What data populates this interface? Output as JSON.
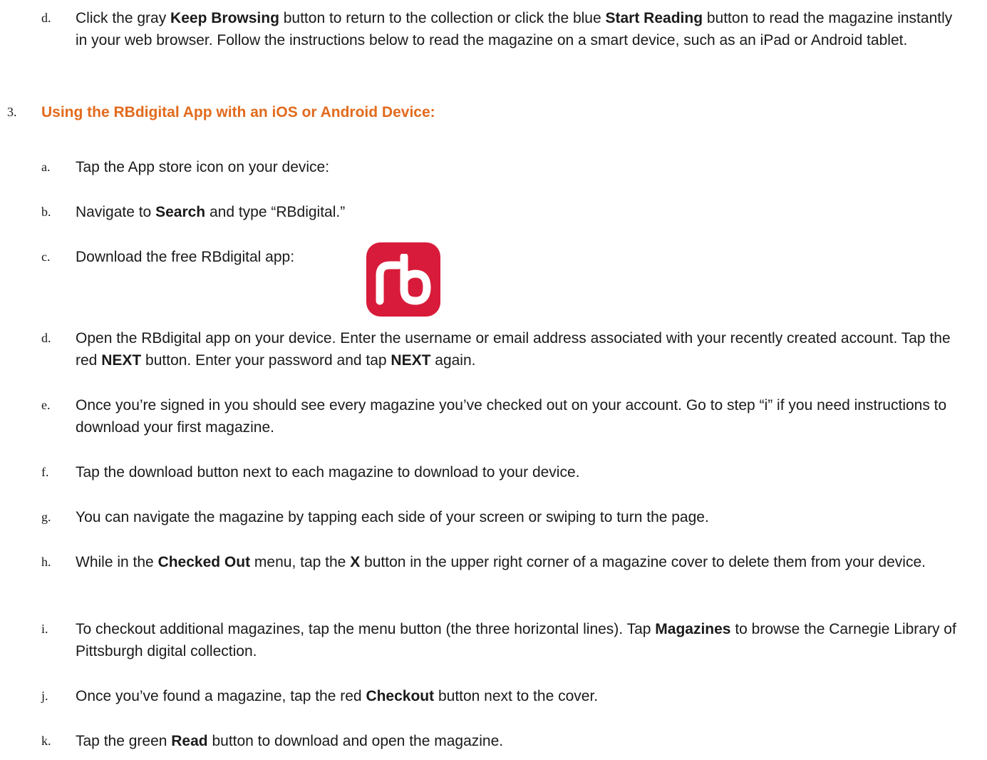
{
  "step_d_top": {
    "marker": "d.",
    "p1": "Click the gray ",
    "b1": "Keep Browsing",
    "p2": " button to return to the collection or click the blue ",
    "b2": "Start Reading",
    "p3": " button to read the magazine instantly in your web browser.  Follow the instructions below to read the magazine on a smart device, such as an iPad or Android tablet."
  },
  "section": {
    "number": "3.",
    "heading": "Using the RBdigital App with an iOS or Android Device:"
  },
  "steps": {
    "a": {
      "marker": "a.",
      "p1": "Tap the App store icon on your device:"
    },
    "b": {
      "marker": "b.",
      "p1": "Navigate to ",
      "b1": "Search",
      "p2": " and type “RBdigital.”"
    },
    "c": {
      "marker": "c.",
      "p1": "Download the free RBdigital app:"
    },
    "d": {
      "marker": "d.",
      "p1": "Open the RBdigital app on your device.  Enter the username or email address associated with your recently created account.  Tap the red ",
      "b1": "NEXT",
      "p2": " button.  Enter your password and tap ",
      "b2": "NEXT",
      "p3": " again."
    },
    "e": {
      "marker": "e.",
      "p1": "Once you’re signed in you should see every magazine you’ve checked out on your account.  Go to step “i” if you need instructions to download your first magazine."
    },
    "f": {
      "marker": "f.",
      "p1": "Tap the download button next to each magazine to download to your device."
    },
    "g": {
      "marker": "g.",
      "p1": "You can navigate the magazine by tapping each side of your screen or swiping to turn the page."
    },
    "h": {
      "marker": "h.",
      "p1": "While in the ",
      "b1": "Checked Out",
      "p2": " menu, tap the ",
      "b2": "X",
      "p3": " button in the upper right corner of a magazine cover to delete them from your device."
    },
    "i": {
      "marker": "i.",
      "p1": "To checkout additional magazines, tap the menu button (the three horizontal lines).  Tap ",
      "b1": "Magazines",
      "p2": " to browse the Carnegie Library of Pittsburgh digital collection."
    },
    "j": {
      "marker": "j.",
      "p1": "Once you’ve found a magazine, tap the red ",
      "b1": "Checkout",
      "p2": " button next to the cover."
    },
    "k": {
      "marker": "k.",
      "p1": "Tap the green ",
      "b1": "Read",
      "p2": " button to download and open the magazine."
    }
  },
  "app_icon": {
    "name": "rbdigital-app-icon",
    "color": "#d81b3a",
    "logo_text": "rb"
  },
  "colors": {
    "heading": "#e26a1c",
    "text": "#1a1a1a"
  }
}
